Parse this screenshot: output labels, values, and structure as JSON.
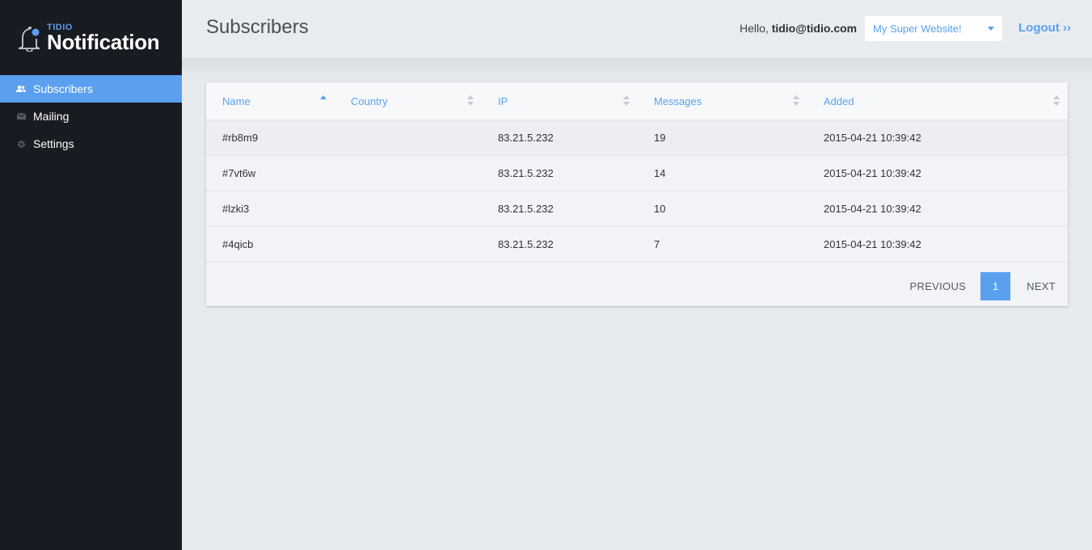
{
  "brand": {
    "small": "TIDIO",
    "big": "Notification",
    "icon": "bell-icon"
  },
  "sidebar": {
    "items": [
      {
        "label": "Subscribers",
        "icon": "users-icon",
        "active": true
      },
      {
        "label": "Mailing",
        "icon": "envelope-icon",
        "active": false
      },
      {
        "label": "Settings",
        "icon": "gear-icon",
        "active": false
      }
    ]
  },
  "header": {
    "title": "Subscribers",
    "hello_prefix": "Hello,",
    "user_email": "tidio@tidio.com",
    "site_select": "My Super Website!",
    "logout": "Logout ››"
  },
  "table": {
    "columns": [
      "Name",
      "Country",
      "IP",
      "Messages",
      "Added"
    ],
    "sorted_column": "Name",
    "rows": [
      {
        "name": "#rb8m9",
        "country": "",
        "ip": "83.21.5.232",
        "messages": "19",
        "added": "2015-04-21 10:39:42"
      },
      {
        "name": "#7vt6w",
        "country": "",
        "ip": "83.21.5.232",
        "messages": "14",
        "added": "2015-04-21 10:39:42"
      },
      {
        "name": "#lzki3",
        "country": "",
        "ip": "83.21.5.232",
        "messages": "10",
        "added": "2015-04-21 10:39:42"
      },
      {
        "name": "#4qicb",
        "country": "",
        "ip": "83.21.5.232",
        "messages": "7",
        "added": "2015-04-21 10:39:42"
      }
    ]
  },
  "pagination": {
    "previous": "PREVIOUS",
    "current": "1",
    "next": "NEXT"
  },
  "colors": {
    "accent": "#5aa0ef",
    "sidebar": "#181b21",
    "background": "#e6e9ed"
  }
}
